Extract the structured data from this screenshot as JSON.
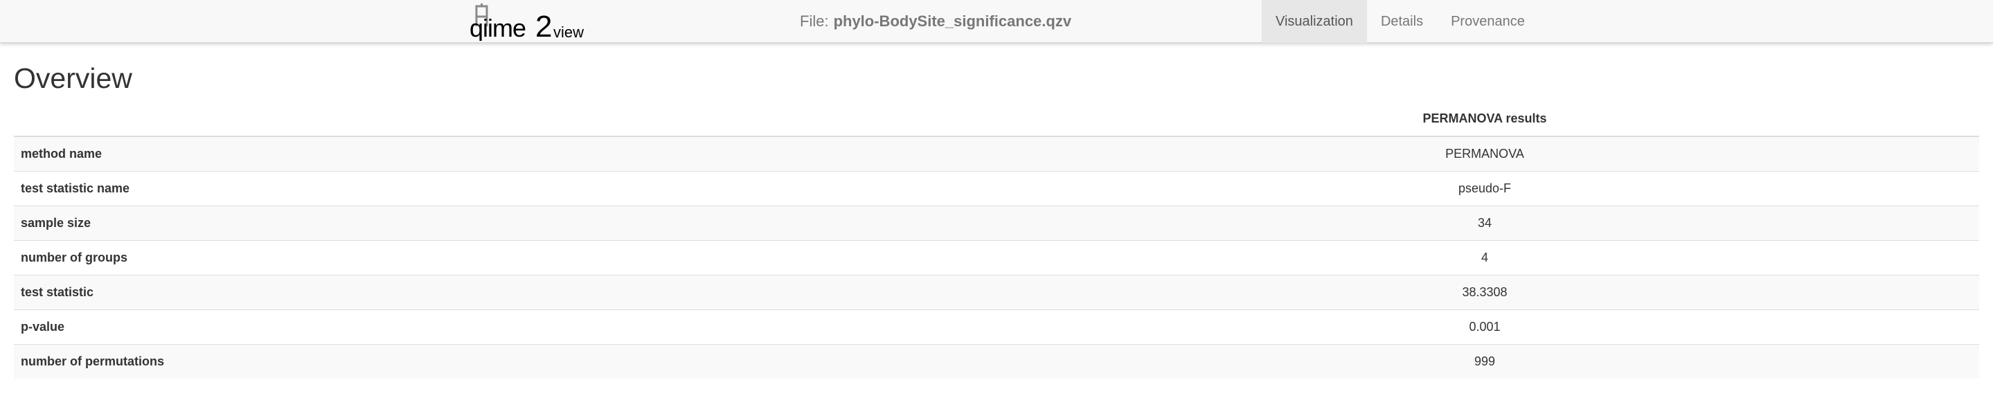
{
  "navbar": {
    "logo_text": "qiime2view",
    "file_prefix": "File:",
    "file_name": "phylo-BodySite_significance.qzv",
    "tabs": [
      {
        "label": "Visualization",
        "active": true
      },
      {
        "label": "Details",
        "active": false
      },
      {
        "label": "Provenance",
        "active": false
      }
    ]
  },
  "main": {
    "title": "Overview",
    "table": {
      "column_header": "PERMANOVA results",
      "rows": [
        {
          "label": "method name",
          "value": "PERMANOVA"
        },
        {
          "label": "test statistic name",
          "value": "pseudo-F"
        },
        {
          "label": "sample size",
          "value": "34"
        },
        {
          "label": "number of groups",
          "value": "4"
        },
        {
          "label": "test statistic",
          "value": "38.3308"
        },
        {
          "label": "p-value",
          "value": "0.001"
        },
        {
          "label": "number of permutations",
          "value": "999"
        }
      ]
    }
  },
  "colors": {
    "navbar_bg": "#f8f8f8",
    "active_tab_bg": "#e7e7e7",
    "text": "#333333",
    "muted_text": "#777777",
    "logo_box": "#888888"
  }
}
